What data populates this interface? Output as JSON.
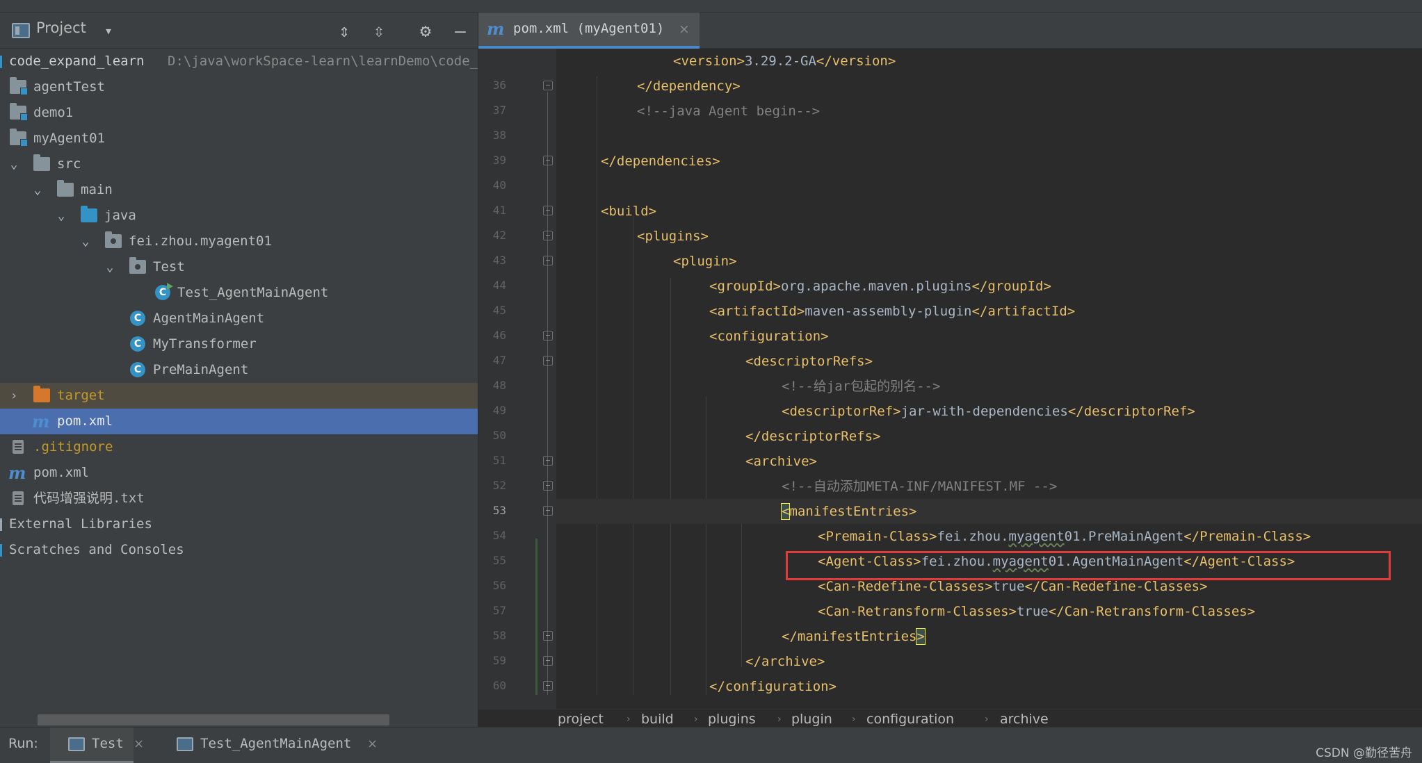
{
  "project_panel": {
    "title": "Project",
    "root": {
      "name": "code_expand_learn",
      "path": "D:\\java\\workSpace-learn\\learnDemo\\code_expand_learn"
    },
    "items": [
      {
        "label": "agentTest"
      },
      {
        "label": "demo1"
      },
      {
        "label": "myAgent01"
      },
      {
        "label": "src"
      },
      {
        "label": "main"
      },
      {
        "label": "java"
      },
      {
        "label": "fei.zhou.myagent01"
      },
      {
        "label": "Test"
      },
      {
        "label": "Test_AgentMainAgent"
      },
      {
        "label": "AgentMainAgent"
      },
      {
        "label": "MyTransformer"
      },
      {
        "label": "PreMainAgent"
      },
      {
        "label": "target"
      },
      {
        "label": "pom.xml"
      },
      {
        "label": ".gitignore"
      },
      {
        "label": "pom.xml"
      },
      {
        "label": "代码增强说明.txt"
      },
      {
        "label": "External Libraries"
      },
      {
        "label": "Scratches and Consoles"
      }
    ]
  },
  "editor": {
    "tab": {
      "label": "pom.xml (myAgent01)",
      "close": "×"
    },
    "current_line": 53,
    "line_numbers": [
      "",
      "36",
      "37",
      "38",
      "39",
      "40",
      "41",
      "42",
      "43",
      "44",
      "45",
      "46",
      "47",
      "48",
      "49",
      "50",
      "51",
      "52",
      "53",
      "54",
      "55",
      "56",
      "57",
      "58",
      "59",
      "60"
    ],
    "code": {
      "l35_open": "<version>",
      "l35_text": "3.29.2-GA",
      "l35_close": "</version>",
      "l36": "</dependency>",
      "l37": "<!--java Agent begin-->",
      "l39": "</dependencies>",
      "l41": "<build>",
      "l42": "<plugins>",
      "l43": "<plugin>",
      "l44_open": "<groupId>",
      "l44_text": "org.apache.maven.plugins",
      "l44_close": "</groupId>",
      "l45_open": "<artifactId>",
      "l45_text": "maven-assembly-plugin",
      "l45_close": "</artifactId>",
      "l46": "<configuration>",
      "l47": "<descriptorRefs>",
      "l48": "<!--给jar包起的别名-->",
      "l49_open": "<descriptorRef>",
      "l49_text": "jar-with-dependencies",
      "l49_close": "</descriptorRef>",
      "l50": "</descriptorRefs>",
      "l51": "<archive>",
      "l52": "<!--自动添加META-INF/MANIFEST.MF -->",
      "l53_lt": "<",
      "l53_rest": "manifestEntries>",
      "l54_open": "<Premain-Class>",
      "l54_a": "fei.zhou.",
      "l54_b": "myagent",
      "l54_c": "01.PreMainAgent",
      "l54_close": "</Premain-Class>",
      "l55_open": "<Agent-Class>",
      "l55_a": "fei.zhou.",
      "l55_b": "myagent",
      "l55_c": "01.AgentMainAgent",
      "l55_close": "</Agent-Class>",
      "l56_open": "<Can-Redefine-Classes>",
      "l56_text": "true",
      "l56_close": "</Can-Redefine-Classes>",
      "l57_open": "<Can-Retransform-Classes>",
      "l57_text": "true",
      "l57_close": "</Can-Retransform-Classes>",
      "l58_rest": "</manifestEntries",
      "l58_gt": ">",
      "l59": "</archive>",
      "l60": "</configuration>"
    },
    "breadcrumbs": [
      "project",
      "build",
      "plugins",
      "plugin",
      "configuration",
      "archive"
    ],
    "breadcrumb_sep": "›"
  },
  "run_bar": {
    "label": "Run:",
    "tabs": [
      {
        "label": "Test",
        "close": "×"
      },
      {
        "label": "Test_AgentMainAgent",
        "close": "×"
      }
    ]
  },
  "watermark": "CSDN @勤径苦舟",
  "colors": {
    "tag": "#e8bf6a",
    "text": "#a9b7c6",
    "comment": "#808080",
    "selection": "#4b6eaf",
    "highlight_box": "#e03a3a"
  }
}
